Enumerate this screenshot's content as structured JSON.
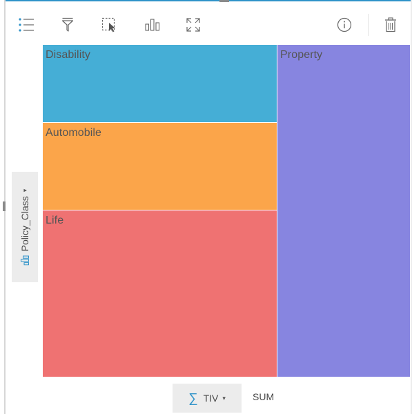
{
  "toolbar": {
    "icons": [
      "legend-icon",
      "filter-icon",
      "selection-icon",
      "visualization-type-icon",
      "maximize-icon",
      "info-icon",
      "delete-icon"
    ]
  },
  "colors": {
    "accent": "#2f93c9",
    "disability": "#45aed6",
    "automobile": "#fba54a",
    "life": "#ef7272",
    "property": "#8785e0"
  },
  "chart_data": {
    "type": "treemap",
    "categories": [
      "Disability",
      "Automobile",
      "Life",
      "Property"
    ],
    "labels": {
      "disability": "Disability",
      "automobile": "Automobile",
      "life": "Life",
      "property": "Property"
    },
    "size_field": "TIV",
    "group_field": "Policy_Class"
  },
  "y_axis": {
    "field": "Policy_Class",
    "caret": "▾"
  },
  "x_axis": {
    "field": "TIV",
    "caret": "▾",
    "aggregation": "SUM"
  }
}
